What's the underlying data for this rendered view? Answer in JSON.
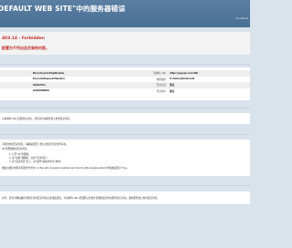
{
  "header": {
    "title": "DEFAULT WEB SITE\"中的服务器错误",
    "host": "localhost"
  },
  "error": {
    "code": "403.14 - Forbidden",
    "message": "配置为不列出此目录的内容。"
  },
  "details": {
    "rows": [
      {
        "l1": "",
        "v1": "DirectoryListingModule",
        "l2": "请求的 URL",
        "v2": "http://qqcsjn.com:80/"
      },
      {
        "l1": "",
        "v1": "ExecuteRequestHandler",
        "l2": "物理路径",
        "v2": "E:\\hmhsj\\htmlrootl"
      },
      {
        "l1": "",
        "v1": "StaticFile",
        "l2": "登录方法",
        "v2": "匿名"
      },
      {
        "l1": "",
        "v1": "0x00000000",
        "l2": "登录用户",
        "v2": "匿名"
      }
    ]
  },
  "cause": {
    "text": "为请求的 URL 配置默认文档，并且没有在服务器上启用目录浏览。"
  },
  "fixes": {
    "line1": "不希望启用目录浏览，请确保配置了默认文档并且该文件存在。",
    "line2": "IIS 管理器启用目录浏览。",
    "line3": "1. 打开 IIS 管理器。",
    "line4": "2. 在\"功能\"视图中，双击\"目录浏览\"。",
    "line5": "3. 在\"目录浏览\"页上，在\"操作\"窗格中单击\"启用\"。",
    "line6": "或站点或应用程序配置文件中的 configuration/system.webServer/directoryBrowse@enabled 特性被设置为 True。"
  },
  "more": {
    "text": "文件，且在为网站或应用程序禁用目录浏览后生成此错误。为请求的 URL 配置默认文档并且确保该文件在服务器上存在，或在服务器上启用目录浏览。"
  }
}
